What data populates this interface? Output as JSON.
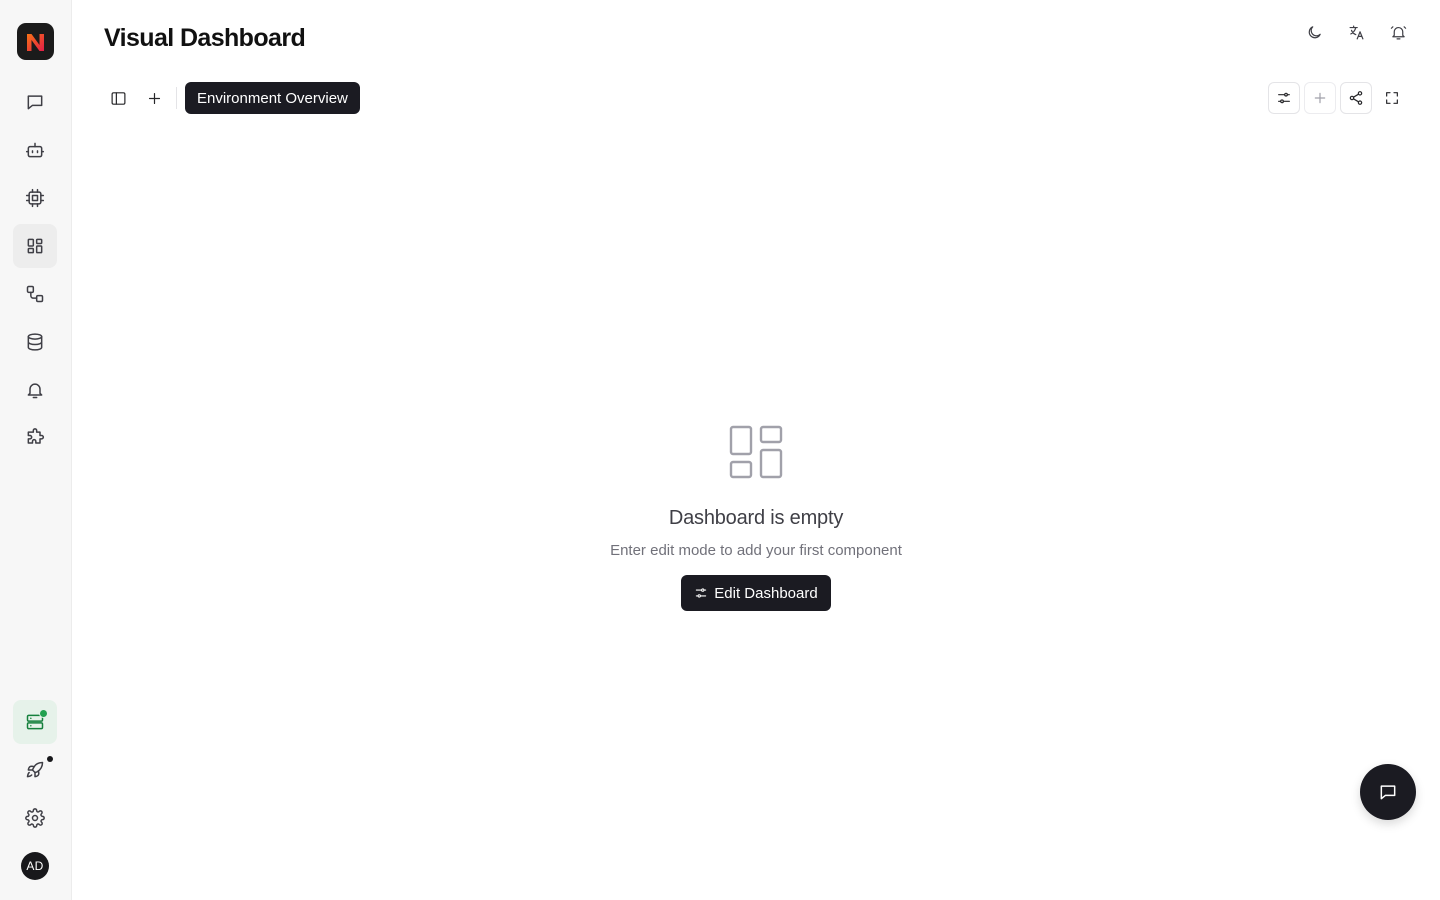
{
  "app": {
    "logo_letter": "N",
    "brand_colors": [
      "#f97316",
      "#e11d48"
    ]
  },
  "header": {
    "title": "Visual Dashboard",
    "actions": [
      {
        "icon": "moon-icon",
        "label": "Toggle theme"
      },
      {
        "icon": "translate-icon",
        "label": "Language"
      },
      {
        "icon": "bell-icon",
        "label": "Notifications"
      }
    ]
  },
  "sidebar": {
    "items": [
      {
        "icon": "chat-icon",
        "name": "chat"
      },
      {
        "icon": "bot-icon",
        "name": "agents"
      },
      {
        "icon": "cpu-icon",
        "name": "models"
      },
      {
        "icon": "dashboard-icon",
        "name": "dashboards",
        "active": true
      },
      {
        "icon": "workflow-icon",
        "name": "workflows"
      },
      {
        "icon": "database-icon",
        "name": "data"
      },
      {
        "icon": "bell-icon",
        "name": "alerts"
      },
      {
        "icon": "puzzle-icon",
        "name": "plugins"
      }
    ],
    "bottom_items": [
      {
        "icon": "server-status-icon",
        "name": "environment-status",
        "status_color": "#22a150"
      },
      {
        "icon": "rocket-icon",
        "name": "deploy",
        "has_notification": true
      },
      {
        "icon": "gear-icon",
        "name": "settings"
      }
    ],
    "avatar_initials": "AD"
  },
  "toolbar": {
    "active_tab": "Environment Overview"
  },
  "empty_state": {
    "title": "Dashboard is empty",
    "subtitle": "Enter edit mode to add your first component",
    "button_label": "Edit Dashboard"
  },
  "colors": {
    "accent_dark": "#1b1b22",
    "status_green": "#22a150",
    "sidebar_bg": "#f7f7f7"
  }
}
